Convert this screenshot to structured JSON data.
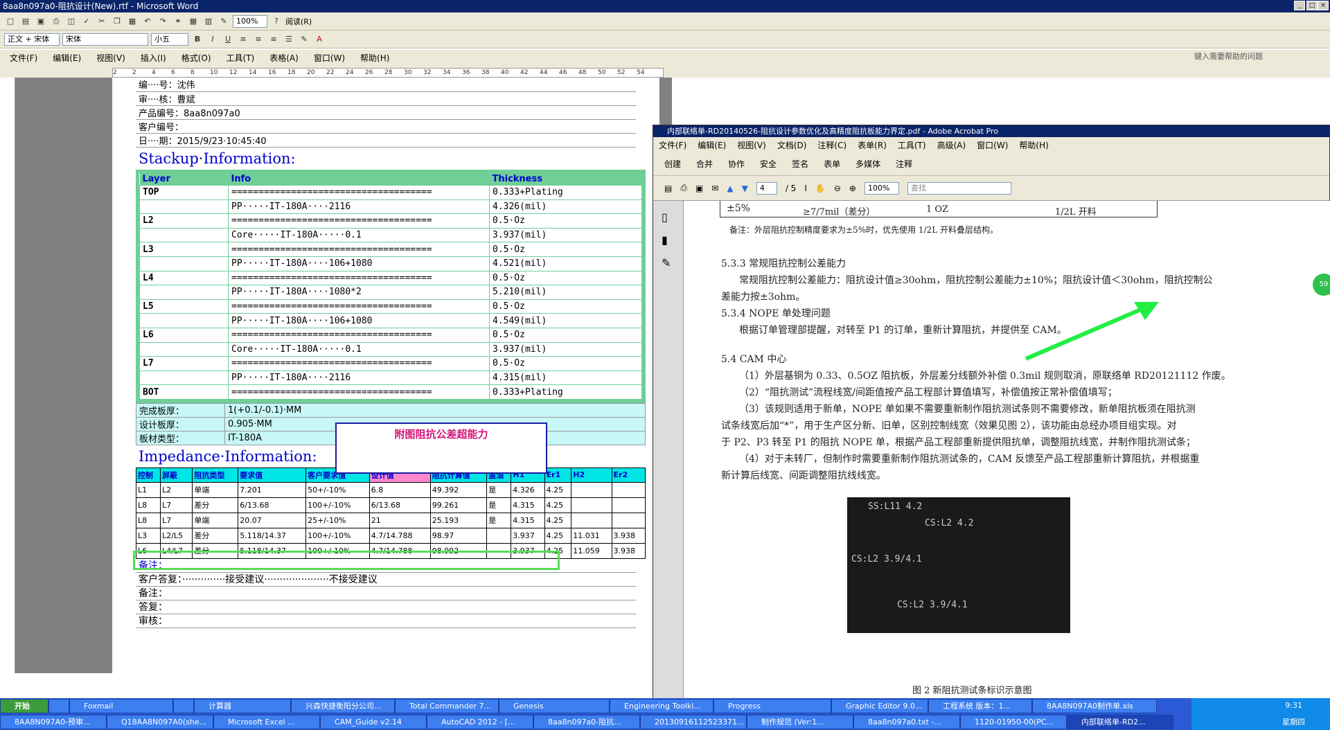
{
  "word": {
    "title": "8aa8n097a0-阻抗设计(New).rtf - Microsoft Word",
    "toolbar": {
      "zoom": "100%",
      "read_btn": "阅读(R)",
      "style": "正文 + 宋体",
      "font": "宋体",
      "size": "小五"
    },
    "menu": [
      "文件(F)",
      "编辑(E)",
      "视图(V)",
      "插入(I)",
      "格式(O)",
      "工具(T)",
      "表格(A)",
      "窗口(W)",
      "帮助(H)"
    ],
    "help_search": "键入需要帮助的问题",
    "ruler_ticks": [
      "2",
      "2",
      "4",
      "6",
      "8",
      "10",
      "12",
      "14",
      "16",
      "18",
      "20",
      "22",
      "24",
      "26",
      "28",
      "30",
      "32",
      "34",
      "36",
      "38",
      "40",
      "42",
      "44",
      "46",
      "48",
      "50",
      "52",
      "54"
    ],
    "header_rows": [
      "编····号：沈伟",
      "审····核：曹斌",
      "产品编号：8aa8n097a0",
      "客户编号：",
      "日····期：2015/9/23·10:45:40"
    ],
    "stackup_title": "Stackup·Information:",
    "stackup_headers": [
      "Layer",
      "Info",
      "Thickness"
    ],
    "stackup_rows": [
      [
        "TOP",
        "=====================================",
        "0.333+Plating"
      ],
      [
        "",
        "PP·····IT-180A····2116",
        "4.326(mil)"
      ],
      [
        "L2",
        "=====================================",
        "0.5·Oz"
      ],
      [
        "",
        "Core·····IT-180A·····0.1",
        "3.937(mil)"
      ],
      [
        "L3",
        "=====================================",
        "0.5·Oz"
      ],
      [
        "",
        "PP·····IT-180A····106+1080",
        "4.521(mil)"
      ],
      [
        "L4",
        "=====================================",
        "0.5·Oz"
      ],
      [
        "",
        "PP·····IT-180A····1080*2",
        "5.210(mil)"
      ],
      [
        "L5",
        "=====================================",
        "0.5·Oz"
      ],
      [
        "",
        "PP·····IT-180A····106+1080",
        "4.549(mil)"
      ],
      [
        "L6",
        "=====================================",
        "0.5·Oz"
      ],
      [
        "",
        "Core·····IT-180A·····0.1",
        "3.937(mil)"
      ],
      [
        "L7",
        "=====================================",
        "0.5·Oz"
      ],
      [
        "",
        "PP·····IT-180A····2116",
        "4.315(mil)"
      ],
      [
        "BOT",
        "=====================================",
        "0.333+Plating"
      ]
    ],
    "board_rows": [
      [
        "完成板厚：",
        "1(+0.1/-0.1)·MM"
      ],
      [
        "设计板厚：",
        "0.905·MM"
      ],
      [
        "板材类型：",
        "IT-180A"
      ]
    ],
    "callout": "附图阻抗公差超能力",
    "impedance_title": "Impedance·Information:",
    "imp_headers": [
      "控制",
      "屏蔽",
      "阻抗类型",
      "要求值",
      "客户要求值",
      "设计值",
      "阻抗计算值",
      "盖油",
      "H1",
      "Er1",
      "H2",
      "Er2"
    ],
    "imp_rows": [
      [
        "L1",
        "L2",
        "单端",
        "7.201",
        "50+/-10%",
        "6.8",
        "49.392",
        "是",
        "4.326",
        "4.25",
        "",
        ""
      ],
      [
        "L8",
        "L7",
        "差分",
        "6/13.68",
        "100+/-10%",
        "6/13.68",
        "99.261",
        "是",
        "4.315",
        "4.25",
        "",
        ""
      ],
      [
        "L8",
        "L7",
        "单端",
        "20.07",
        "25+/-10%",
        "21",
        "25.193",
        "是",
        "4.315",
        "4.25",
        "",
        ""
      ],
      [
        "L3",
        "L2/L5",
        "差分",
        "5.118/14.37",
        "100+/-10%",
        "4.7/14.788",
        "98.97",
        "",
        "3.937",
        "4.25",
        "11.031",
        "3.938"
      ],
      [
        "L6",
        "L4/L7",
        "差分",
        "5.118/14.37",
        "100+/-10%",
        "4.7/14.788",
        "98.992",
        "",
        "3.937",
        "4.25",
        "11.059",
        "3.938"
      ]
    ],
    "notes": [
      "备注：",
      "客户答复：··············接受建议·····················不接受建议",
      "备注：",
      "答复：",
      "审核："
    ]
  },
  "acrobat": {
    "title": "内部联络单-RD20140526-阻抗设计参数优化及高精度阻抗板能力界定.pdf - Adobe Acrobat Pro",
    "menu": [
      "文件(F)",
      "编辑(E)",
      "视图(V)",
      "文档(D)",
      "注释(C)",
      "表单(R)",
      "工具(T)",
      "高级(A)",
      "窗口(W)",
      "帮助(H)"
    ],
    "tools": [
      "创建",
      "合并",
      "协作",
      "安全",
      "签名",
      "表单",
      "多媒体",
      "注释"
    ],
    "page_num": "4",
    "page_total": "/ 5",
    "zoom": "100%",
    "find": "查找",
    "pdf_lines": {
      "row1a": "±5%",
      "row1b": "≥7/7mil（差分）",
      "row1c": "1 OZ",
      "row1d": "1/2L 开料",
      "note": "备注：外层阻抗控制精度要求为±5%时，优先使用 1/2L 开料叠层结构。",
      "h533": "5.3.3 常规阻抗控制公差能力",
      "p533a": "常规阻抗控制公差能力：阻抗设计值≥30ohm，阻抗控制公差能力±10%；阻抗设计值＜30ohm，阻抗控制公",
      "p533b": "差能力按±3ohm。",
      "h534": "5.3.4 NOPE 单处理问题",
      "p534": "根据订单管理部提醒，对转至 P1 的订单，重新计算阻抗，并提供至 CAM。",
      "h54": "5.4 CAM 中心",
      "p54a": "（1）外层基铜为 0.33、0.5OZ 阻抗板，外层差分线额外补偿 0.3mil 规则取消，原联络单 RD20121112 作废。",
      "p54b": "（2）“阻抗测试”流程线宽/间距值按产品工程部计算值填写，补偿值按正常补偿值填写；",
      "p54c": "（3）该规则适用于新单，NOPE 单如果不需要重新制作阻抗测试条则不需要修改，新单阻抗板须在阻抗测",
      "p54d": "试条线宽后加“*”，用于生产区分新、旧单，区别控制线宽（效果见图 2），该功能由总经办项目组实现。对",
      "p54e": "于 P2、P3 转至 P1 的阻抗 NOPE 单，根据产品工程部重新提供阻抗单，调整阻抗线宽，并制作阻抗测试条；",
      "p54f": "（4）对于未转厂，但制作时需要重新制作阻抗测试条的，CAM 反馈至产品工程部重新计算阻抗，并根据重",
      "p54g": "新计算后线宽、间距调整阻抗线线宽。",
      "fig": "图 2 新阻抗测试条标识示意图",
      "pcb1": "SS:L11 4.2",
      "pcb2": "CS:L2 4.2",
      "pcb3": "CS:L2 3.9/4.1",
      "pcb4": "CS:L2 3.9/4.1"
    }
  },
  "taskbar": {
    "row1": [
      "开始",
      "",
      "Foxmail",
      "",
      "计算器",
      "兴森快捷衡阳分公司...",
      "Total Commander 7...",
      "Genesis",
      "Engineering Toolki...",
      "Progress",
      "Graphic Editor 9.0...",
      "工程系统  版本：1...",
      "8AA8N097A0制作单.xls"
    ],
    "row2": [
      "8AA8N097A0-预审...",
      "Q18AA8N097A0(she...",
      "Microsoft Excel ...",
      "CAM_Guide v2.14",
      "AutoCAD 2012 - [...",
      "8aa8n097a0-阻抗...",
      "20130916112523371...",
      "制作规范 (Ver:1...",
      "8aa8n097a0.txt -...",
      "1120-01950-00(PC...",
      "内部联络单-RD2..."
    ],
    "clock": "9:31",
    "day": "星期四"
  },
  "badge": "59"
}
